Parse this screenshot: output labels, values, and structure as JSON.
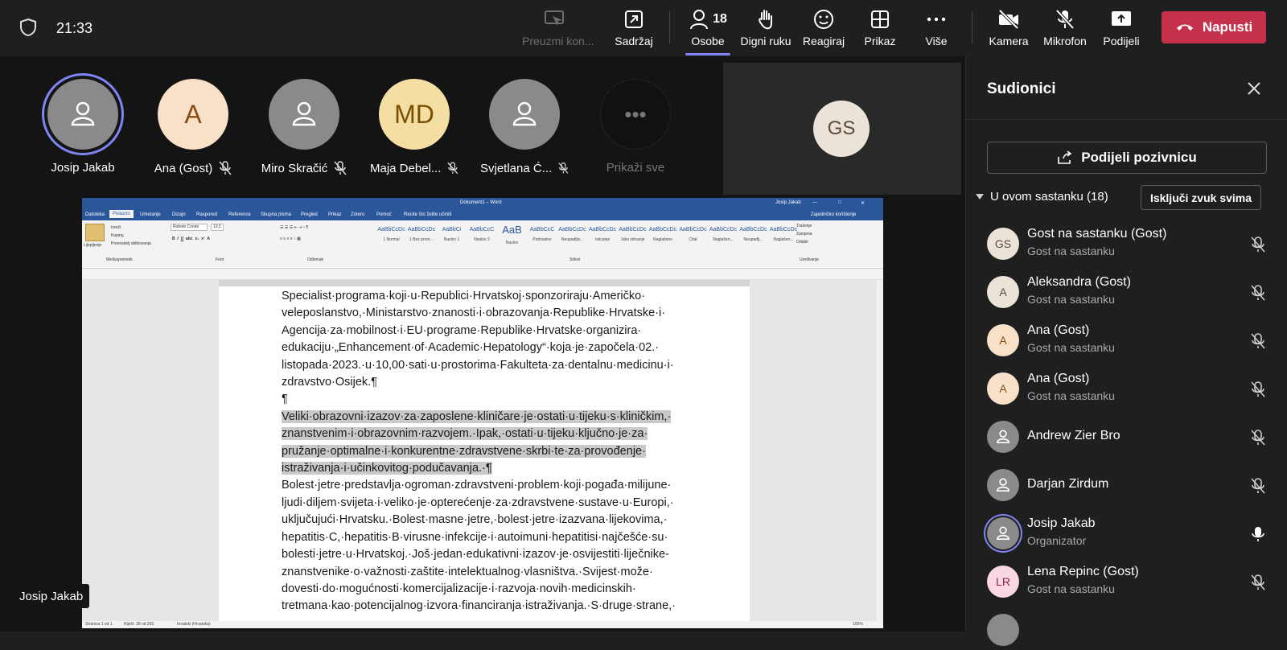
{
  "topbar": {
    "time": "21:33",
    "buttons": [
      {
        "label": "Preuzmi kon...",
        "icon": "take-control-icon",
        "disabled": true
      },
      {
        "label": "Sadržaj",
        "icon": "share-content-icon"
      },
      {
        "label": "Osobe",
        "icon": "people-icon",
        "count": "18"
      },
      {
        "label": "Digni ruku",
        "icon": "raise-hand-icon"
      },
      {
        "label": "Reagiraj",
        "icon": "react-icon"
      },
      {
        "label": "Prikaz",
        "icon": "view-icon"
      },
      {
        "label": "Više",
        "icon": "more-icon"
      },
      {
        "label": "Kamera",
        "icon": "camera-off-icon"
      },
      {
        "label": "Mikrofon",
        "icon": "mic-off-icon"
      },
      {
        "label": "Podijeli",
        "icon": "share-tray-icon"
      }
    ],
    "leave_label": "Napusti"
  },
  "stage": {
    "participants": [
      {
        "name": "Josip Jakab",
        "initials": "",
        "muted": false
      },
      {
        "name": "Ana (Gost)",
        "initials": "A",
        "muted": true
      },
      {
        "name": "Miro Skračić",
        "initials": "",
        "muted": true
      },
      {
        "name": "Maja Debel...",
        "initials": "MD",
        "muted": true
      },
      {
        "name": "Svjetlana Ć...",
        "initials": "",
        "muted": true
      }
    ],
    "show_all_label": "Prikaži sve",
    "show_all_glyph": "•••",
    "large_tile_initials": "GS",
    "presenter_label": "Josip Jakab"
  },
  "word": {
    "title": "Dokument1 – Word",
    "user": "Josip Jakab",
    "tabs": [
      "Datoteka",
      "Polazno",
      "Umetanje",
      "Dizajn",
      "Raspored",
      "Reference",
      "Skupna pisma",
      "Pregled",
      "Prikaz",
      "Zotero",
      "Pomoć"
    ],
    "active_tab": "Polazno",
    "tell_me": "Recite što želite učiniti",
    "share_label": "Zajedničko korištenje",
    "ribbon": {
      "paste": "Lijepljenje",
      "cut": "Izreži",
      "copy": "Kopiraj",
      "format_painter": "Prenositelj oblikovanja",
      "font_name": "Roboto Conde",
      "font_size": "13,5",
      "group_clipboard": "Međuspremnik",
      "group_font": "Font",
      "group_paragraph": "Odlomak",
      "group_styles": "Stilovi",
      "group_editing": "Uređivanje",
      "find": "Traženje",
      "replace": "Zamjena",
      "select": "Odabir",
      "styles": [
        {
          "preview": "AaBbCcDc",
          "name": "1 Normal"
        },
        {
          "preview": "AaBbCcDc",
          "name": "1 Bez prore..."
        },
        {
          "preview": "AaBbCi",
          "name": "Naslov 1"
        },
        {
          "preview": "AaBbCcC",
          "name": "Naslov 2"
        },
        {
          "preview": "AaB",
          "name": "Naslov"
        },
        {
          "preview": "AaBbCcC",
          "name": "Podnaslov"
        },
        {
          "preview": "AaBbCcDc",
          "name": "Neupadljiv..."
        },
        {
          "preview": "AaBbCcDc",
          "name": "Isticanje"
        },
        {
          "preview": "AaBbCcDc",
          "name": "Jako isticanje"
        },
        {
          "preview": "AaBbCcDc",
          "name": "Naglašeno"
        },
        {
          "preview": "AaBbCcDc",
          "name": "Citat"
        },
        {
          "preview": "AaBbCcDc",
          "name": "Naglašen..."
        },
        {
          "preview": "AaBbCcDc",
          "name": "Neupadlj..."
        },
        {
          "preview": "AaBbCcDc",
          "name": "Naglašen..."
        }
      ]
    },
    "paragraphs": [
      {
        "text": "Specialist·programa·koji·u·Republici·Hrvatskoj·sponzoriraju·Američko· veleposlanstvo,·Ministarstvo·znanosti·i·obrazovanja·Republike·Hrvatske·i· Agencija·za·mobilnost·i·EU·programe·Republike·Hrvatske·organizira· edukaciju·„Enhancement·of·Academic·Hepatology“·koja·je·započela·02.· listopada·2023.·u·10,00·sati·u·prostorima·Fakulteta·za·dentalnu·medicinu·i· zdravstvo·Osijek.¶",
        "highlight": false
      },
      {
        "text": "¶",
        "highlight": false
      },
      {
        "text": "Veliki·obrazovni·izazov·za·zaposlene·kliničare·je·ostati·u·tijeku·s·kliničkim,· znanstvenim·i·obrazovnim·razvojem.·Ipak,·ostati·u·tijeku·ključno·je·za· pružanje·optimalne·i·konkurentne·zdravstvene·skrbi·te·za·provođenje· istraživanja·i·učinkovitog·podučavanja.·¶",
        "highlight": true
      },
      {
        "text": "Bolest·jetre·predstavlja·ogroman·zdravstveni·problem·koji·pogađa·milijune· ljudi·diljem·svijeta·i·veliko·je·opterećenje·za·zdravstvene·sustave·u·Europi,· uključujući·Hrvatsku.·Bolest·masne·jetre,·bolest·jetre·izazvana·lijekovima,· hepatitis·C,·hepatitis·B·virusne·infekcije·i·autoimuni·hepatitisi·najčešće·su· bolesti·jetre·u·Hrvatskoj.·Još·jedan·edukativni·izazov·je·osvijestiti·liječnike-znanstvenike·o·važnosti·zaštite·intelektualnog·vlasništva.·Svijest·može· dovesti·do·mogućnosti·komercijalizacije·i·razvoja·novih·medicinskih· tretmana·kao·potencijalnog·izvora·financiranja·istraživanja.·S·druge·strane,·",
        "highlight": false
      }
    ],
    "status": {
      "page": "Stranica 1 od 1",
      "words": "Riječi: 38 od 265",
      "language": "hrvatski (Hrvatska)",
      "zoom": "100%"
    }
  },
  "panel": {
    "title": "Sudionici",
    "invite_label": "Podijeli pozivnicu",
    "section_label": "U ovom sastanku (18)",
    "mute_all_label": "Isključi zvuk svima",
    "people": [
      {
        "name": "Gost na sastanku (Gost)",
        "role": "Gost na sastanku",
        "initials": "GS",
        "muted": true
      },
      {
        "name": "Aleksandra (Gost)",
        "role": "Gost na sastanku",
        "initials": "A",
        "muted": true
      },
      {
        "name": "Ana (Gost)",
        "role": "Gost na sastanku",
        "initials": "A",
        "muted": true
      },
      {
        "name": "Ana (Gost)",
        "role": "Gost na sastanku",
        "initials": "A",
        "muted": true
      },
      {
        "name": "Andrew Zier Bro",
        "role": "",
        "initials": "",
        "muted": true
      },
      {
        "name": "Darjan Zirdum",
        "role": "",
        "initials": "",
        "muted": true
      },
      {
        "name": "Josip Jakab",
        "role": "Organizator",
        "initials": "",
        "muted": false
      },
      {
        "name": "Lena Repinc (Gost)",
        "role": "Gost na sastanku",
        "initials": "LR",
        "muted": true
      }
    ]
  },
  "colors": {
    "accent": "#7f85f5",
    "leave": "#c4314b",
    "word_blue": "#2b579a",
    "background": "#1f1f1f"
  }
}
